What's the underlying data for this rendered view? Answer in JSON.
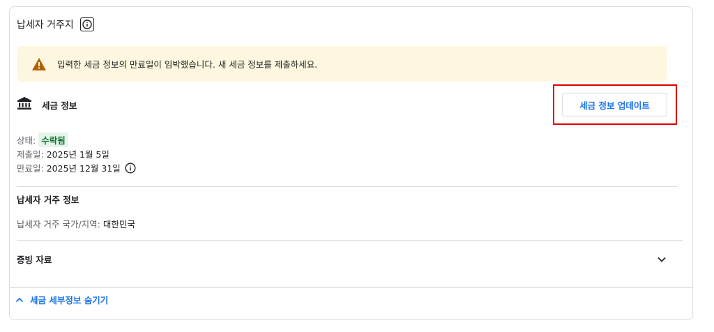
{
  "residence": {
    "title": "납세자 거주지",
    "info_icon": "info-icon"
  },
  "banner": {
    "icon": "warning-icon",
    "message": "입력한 세금 정보의 만료일이 임박했습니다. 새 세금 정보를 제출하세요."
  },
  "tax_info": {
    "icon": "bank-icon",
    "label": "세금 정보",
    "update_button": "세금 정보 업데이트",
    "status_label": "상태:",
    "status_value": "수락됨",
    "submitted_label": "제출일:",
    "submitted_value": "2025년 1월 5일",
    "expiry_label": "만료일:",
    "expiry_value": "2025년 12월 31일"
  },
  "residency": {
    "title": "납세자 거주 정보",
    "country_label": "납세자 거주 국가/지역:",
    "country_value": "대한민국"
  },
  "evidence": {
    "title": "증빙 자료",
    "expand_icon": "chevron-down-icon"
  },
  "footer": {
    "toggle_label": "세금 세부정보 숨기기",
    "toggle_icon": "chevron-up-icon"
  },
  "colors": {
    "accent": "#1a73e8",
    "warning": "#b06000",
    "banner_bg": "#fef7e0",
    "success_bg": "#e6f4ea",
    "success_text": "#137333",
    "highlight": "#e00000"
  }
}
